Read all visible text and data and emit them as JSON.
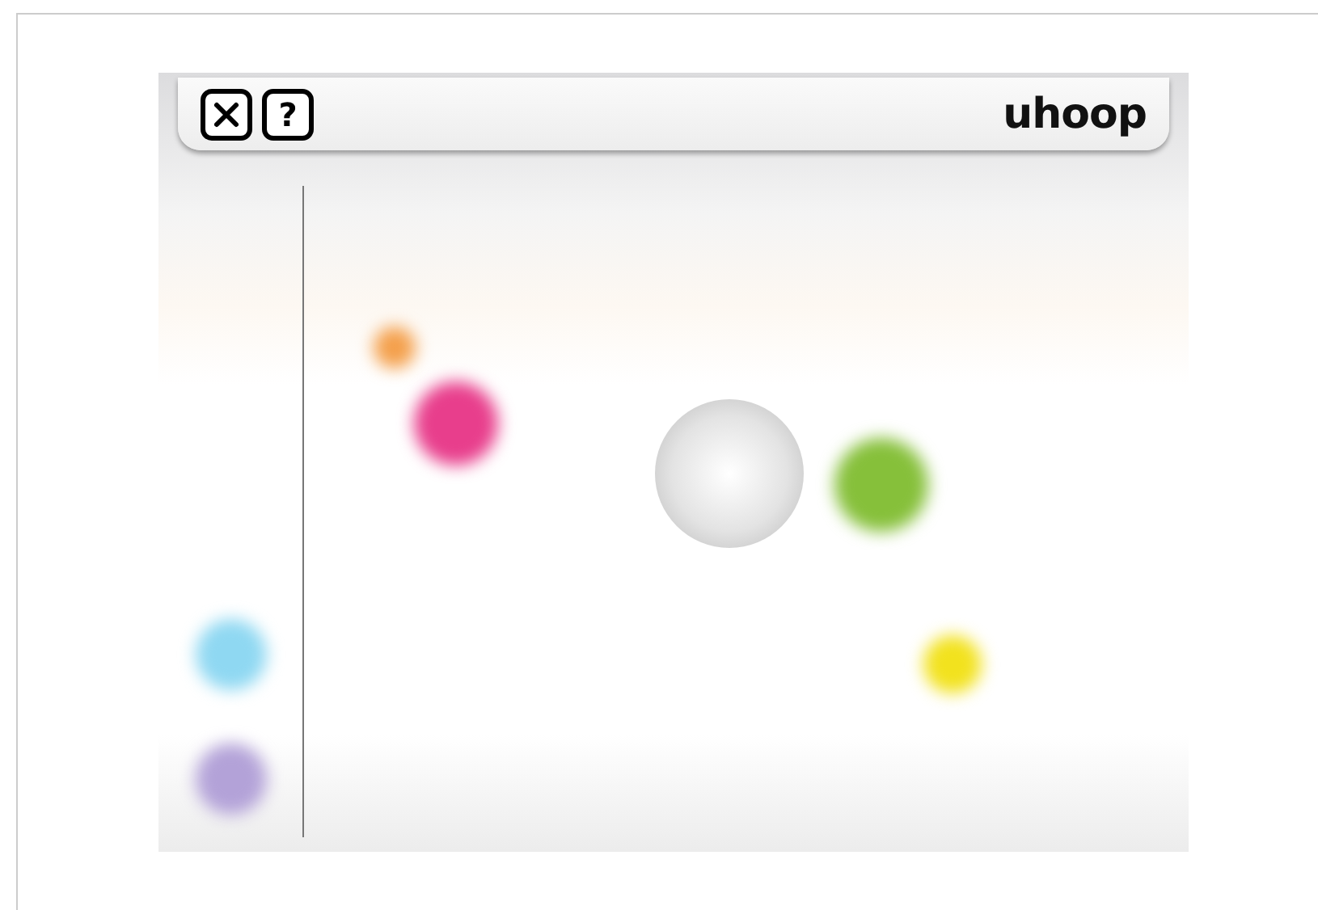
{
  "header": {
    "help_label": "?",
    "brand": "uhoop"
  },
  "dots": [
    {
      "color": "#f4a04c"
    },
    {
      "color": "#e83e8c"
    },
    {
      "color": "#86c03a"
    },
    {
      "color": "#f2e21e"
    },
    {
      "color": "#8fd8f2"
    },
    {
      "color": "#b3a2d8"
    }
  ]
}
